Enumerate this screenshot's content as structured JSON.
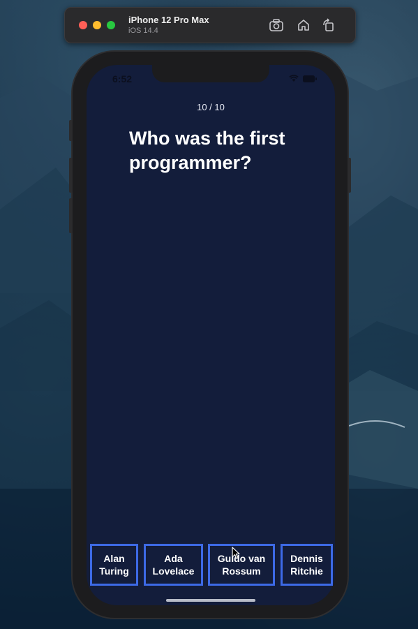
{
  "simulator": {
    "device_name": "iPhone 12 Pro Max",
    "os_version": "iOS 14.4",
    "buttons": [
      "screenshot-icon",
      "home-icon",
      "rotate-icon"
    ]
  },
  "status_bar": {
    "time": "6:52",
    "icons": [
      "wifi-icon",
      "battery-icon"
    ]
  },
  "quiz": {
    "progress": "10 / 10",
    "question": "Who was the first programmer?",
    "answers": [
      "Alan\nTuring",
      "Ada\nLovelace",
      "Guido van\nRossum",
      "Dennis\nRitchie"
    ]
  },
  "colors": {
    "screen_background": "#131d3b",
    "answer_border": "#3d6ae6",
    "text": "#ffffff"
  }
}
